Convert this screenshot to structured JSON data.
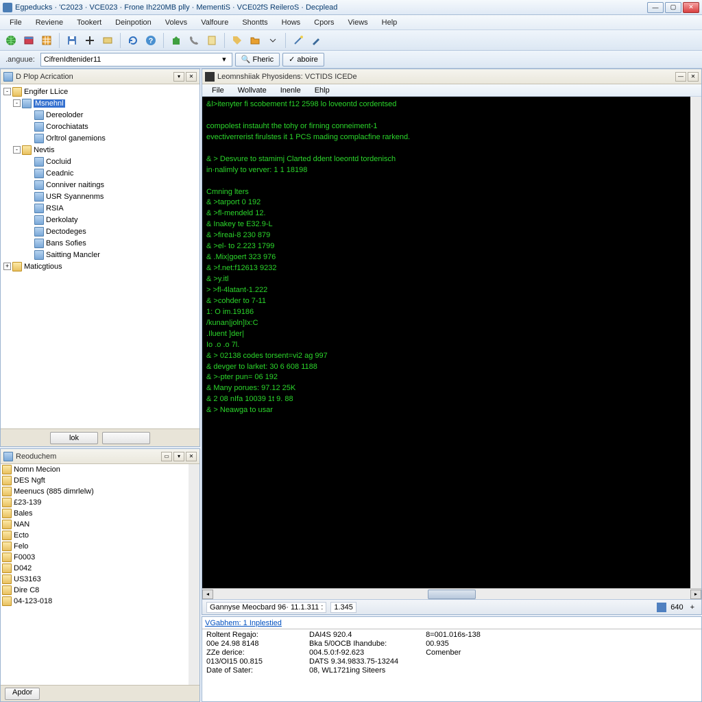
{
  "window": {
    "title": "Egpeducks · 'C2023 · VCE023 · Frone Ih220MB plly · MementiS · VCE02fS ReileroS · Decplead"
  },
  "menu": [
    "File",
    "Reviene",
    "Tookert",
    "Deinpotion",
    "Volevs",
    "Valfoure",
    "Shontts",
    "Hows",
    "Cpors",
    "Views",
    "Help"
  ],
  "addr": {
    "label": ".anguue:",
    "value": "CifrenIdtenider11",
    "btn1": "Fheric",
    "btn2": "aboire"
  },
  "tree_panel": {
    "title": "D Plop Acrication",
    "root": "Engifer LLice",
    "sel": "Msnehnl",
    "items_a": [
      "Dereoloder",
      "Corochiatats",
      "Orltrol ganemions"
    ],
    "node_b": "Nevtis",
    "items_b": [
      "Cocluid",
      "Ceadnic",
      "Conniver naitings",
      "USR Syannenms",
      "RSIA",
      "Derkolaty",
      "Dectodeges",
      "Bans Sofies",
      "Saitting Mancler"
    ],
    "node_c": "Maticgtious",
    "btn1": "lok",
    "btn2": ""
  },
  "files_panel": {
    "title": "Reoduchem",
    "items": [
      "Nomn Mecion",
      "DES Ngft",
      "Meenucs (885 dimrlelw)",
      "£23-139",
      "Bales",
      "NAN",
      "Ecto",
      "Felo",
      "F0003",
      "D042",
      "US3163",
      "Dire C8",
      "04-123-018"
    ],
    "btn": "Apdor"
  },
  "term_panel": {
    "title": "Leomnshiiak Phyosidens: VCTIDS ICEDe",
    "menu": [
      "File",
      "Wollvate",
      "Inenle",
      "Ehlp"
    ],
    "lines": [
      "&l>itenyter fi scobement f12 2598 lo loveontd cordentsed",
      "",
      "compolest instauht the tohy or firning conneiment-1",
      "evectiverrerist firulstes it 1 PCS mading complacfine rarkend.",
      "",
      "& > Desvure to stamimj Clarted ddent loeontd tordenisch",
      "in·nalimly to verver: 1 1 18198",
      "",
      "Cmning lters",
      "& >tarport 0 192",
      "& >fl-mendeld 12.",
      "& Inakey te E32.9-L",
      "& >fireai-8 230 879",
      "& >el- to 2.223 1799",
      "& .Mix|goert 323 976",
      "& >f.net:f12613 9232",
      "& >y.itl",
      "> >fl-4latant-1.222",
      "& >cohder to 7-11",
      "1: O im.19186",
      "/kunan|joln]Ix:C",
      ".Iluent ]der|",
      "Io .o .o 7l.",
      "& > 02138 codes torsent=vi2 ag 997",
      "& devger to larket: 30 6 608 1188",
      "& >-pter pun= 06 192",
      "& Many porues: 97.12 25K",
      "& 2 08 nIfa 10039 1t 9. 88",
      "& > Neawga to usar"
    ]
  },
  "status": {
    "left": "Gannyse Meocbard 96· 11.1.311 :",
    "left2": "1.345",
    "right": "640"
  },
  "info": {
    "header": "VGabhem: 1 Inplestied",
    "rows1": [
      [
        "Roltent Regajo:",
        "DAI4S 920.4"
      ],
      [
        "00e 24.98 8148",
        "Bka 5/0OCB Ihandube:"
      ],
      [
        "ZZe derice:",
        "004.5.0:f-92.623"
      ],
      [
        "013/OI15 00.815",
        "DATS 9.34.9833.75-13244"
      ],
      [
        "Date of Sater:",
        "08, WL1721ing Siteers"
      ]
    ],
    "rows2": [
      [
        "8=001.016s-138",
        ""
      ],
      [
        "00.935",
        ""
      ],
      [
        "Comenber",
        ""
      ]
    ]
  }
}
